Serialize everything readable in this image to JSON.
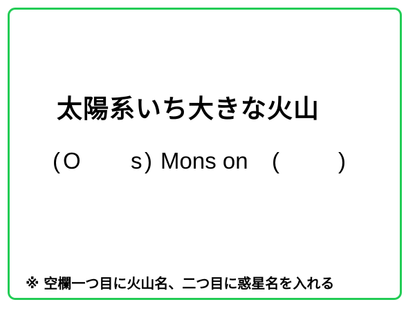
{
  "title": "太陽系いち大きな火山",
  "puzzle": {
    "open_paren_1": "(",
    "fragment_1": "O",
    "fragment_2": "s",
    "close_paren_1": ")",
    "middle_text": "Mons on",
    "open_paren_2": "(",
    "close_paren_2": ")"
  },
  "note": "※ 空欄一つ目に火山名、二つ目に惑星名を入れる",
  "colors": {
    "frame_border": "#22cc55",
    "text": "#000000",
    "background": "#ffffff"
  }
}
